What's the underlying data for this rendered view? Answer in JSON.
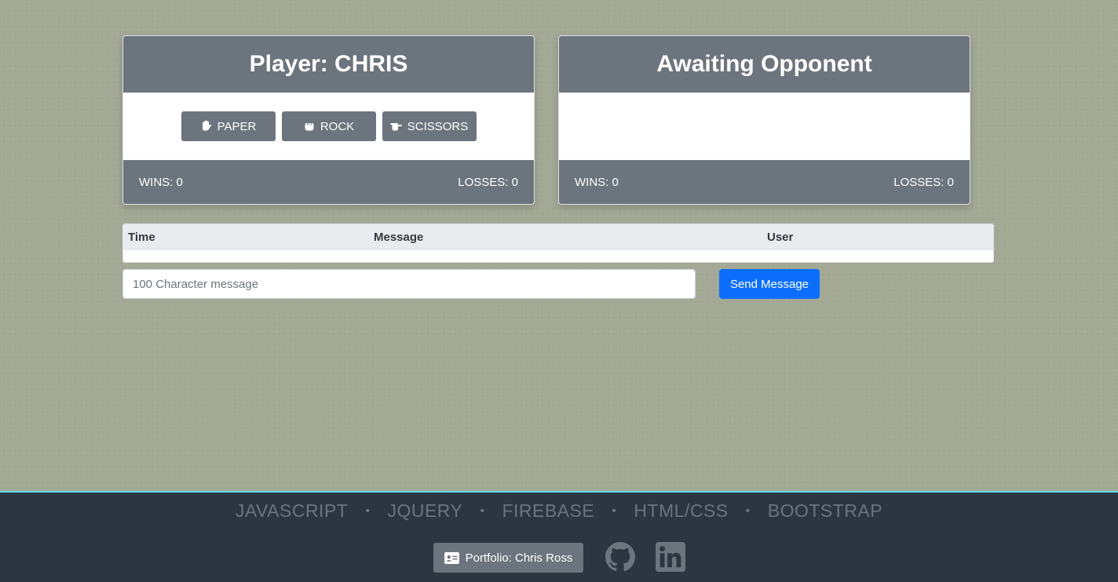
{
  "player_card": {
    "title": "Player: CHRIS",
    "choices": [
      {
        "label": "PAPER",
        "icon": "hand-paper-icon"
      },
      {
        "label": "ROCK",
        "icon": "hand-rock-icon"
      },
      {
        "label": "SCISSORS",
        "icon": "hand-scissors-icon"
      }
    ],
    "wins": "WINS: 0",
    "losses": "LOSSES: 0"
  },
  "opponent_card": {
    "title": "Awaiting Opponent",
    "wins": "WINS: 0",
    "losses": "LOSSES: 0"
  },
  "chat": {
    "columns": [
      "Time",
      "Message",
      "User"
    ],
    "rows": [],
    "input_placeholder": "100 Character message",
    "send_label": "Send Message"
  },
  "footer": {
    "tech": [
      "JAVASCRIPT",
      "JQUERY",
      "FIREBASE",
      "HTML/CSS",
      "BOOTSTRAP"
    ],
    "separator": "•",
    "portfolio_label": "Portfolio: Chris Ross",
    "portfolio_icon": "id-card-icon",
    "social": [
      "github-icon",
      "linkedin-icon"
    ]
  },
  "colors": {
    "background": "#a4a996",
    "card_header": "#6c757d",
    "primary": "#0d6efd",
    "footer_bg": "#2c3540",
    "footer_accent": "#5fd8e6"
  }
}
